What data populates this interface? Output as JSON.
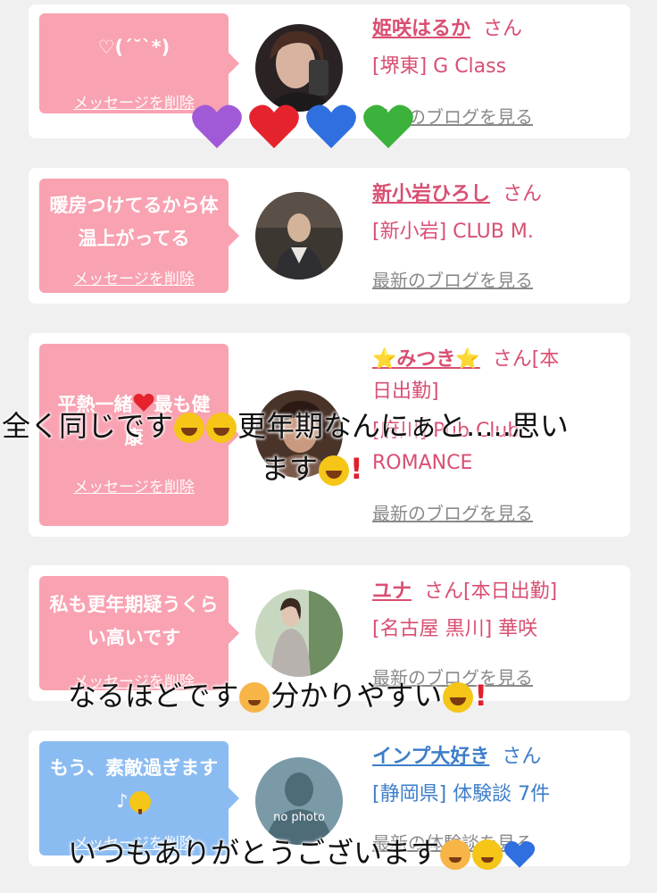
{
  "cards": [
    {
      "message": "♡(´˘`*)",
      "delete_label": "メッセージを削除",
      "name": "姫咲はるか",
      "san": "さん",
      "shop": "[堺東] G Class",
      "blog": "最新のブログを見る"
    },
    {
      "message": "暖房つけてるから体温上がってる",
      "delete_label": "メッセージを削除",
      "name": "新小岩ひろし",
      "san": "さん",
      "shop": "[新小岩] CLUB M.",
      "blog": "最新のブログを見る"
    },
    {
      "message_part1": "平熱一緒",
      "message_part2": "最も健",
      "message_line2": "康",
      "delete_label": "メッセージを削除",
      "name": "⭐みつき⭐",
      "san": "さん[本",
      "san_line2": "日出勤]",
      "shop": "[府川] Pub Club",
      "shop_line2": "ROMANCE",
      "blog": "最新のブログを見る"
    },
    {
      "message": "私も更年期疑うくらい高いです",
      "delete_label": "メッセージを削除",
      "name": "ユナ",
      "san": "さん[本日出勤]",
      "shop": "[名古屋 黒川] 華咲",
      "blog": "最新のブログを見る"
    },
    {
      "message": "もう、素敵過ぎます♪",
      "delete_label": "メッセージを削除",
      "name": "インプ大好き",
      "san": "さん",
      "shop": "[静岡県] 体験談 7件",
      "blog": "最新の体験談を見る",
      "avatar_text": "no photo"
    }
  ],
  "overlays": {
    "line1a": "全く同じです",
    "line1b": "更年期なんにぁと.....思い",
    "line1c": "ます",
    "line2": "なるほどです",
    "line2b": "分かりやすい",
    "line3": "いつもありがとうございます"
  },
  "colors": {
    "pink_accent": "#d94f72",
    "blue_accent": "#3d7ec9",
    "bubble_pink": "#f9a2b1",
    "bubble_blue": "#8bbcf1"
  }
}
